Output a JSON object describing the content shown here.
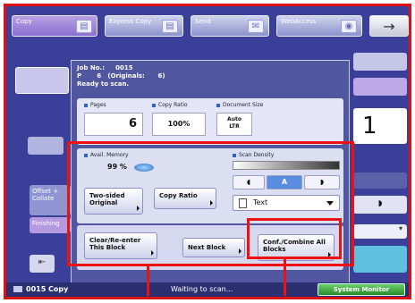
{
  "tabs": [
    {
      "label": "Copy"
    },
    {
      "label": "Express Copy"
    },
    {
      "label": "Send"
    },
    {
      "label": "WebAccess"
    }
  ],
  "dialog": {
    "job_line": "Job No.:     0015",
    "pages_line": "P       6   (Originals:      6)",
    "status_line": "Ready to scan.",
    "pages_label": "Pages",
    "pages_value": "6",
    "ratio_label": "Copy Ratio",
    "ratio_value": "100%",
    "docsize_label": "Document Size",
    "docsize_value_line1": "Auto",
    "docsize_value_line2": "LTR",
    "memory_label": "Avail. Memory",
    "memory_value": "99 %",
    "density_label": "Scan Density",
    "density_auto": "A",
    "text_mode": "Text",
    "two_sided": "Two-sided Original",
    "copy_ratio_btn": "Copy Ratio",
    "clear_btn": "Clear/Re-enter This Block",
    "next_btn": "Next Block",
    "conf_btn": "Conf./Combine All Blocks"
  },
  "background": {
    "offset_label": "Offset + Collate",
    "finishing_label": "Finishing",
    "copy_count": "1"
  },
  "status": {
    "job": "0015  Copy",
    "message": "Waiting to scan...",
    "system_monitor": "System Monitor"
  },
  "colors": {
    "highlight": "#e11",
    "accent": "#2d64d0"
  }
}
